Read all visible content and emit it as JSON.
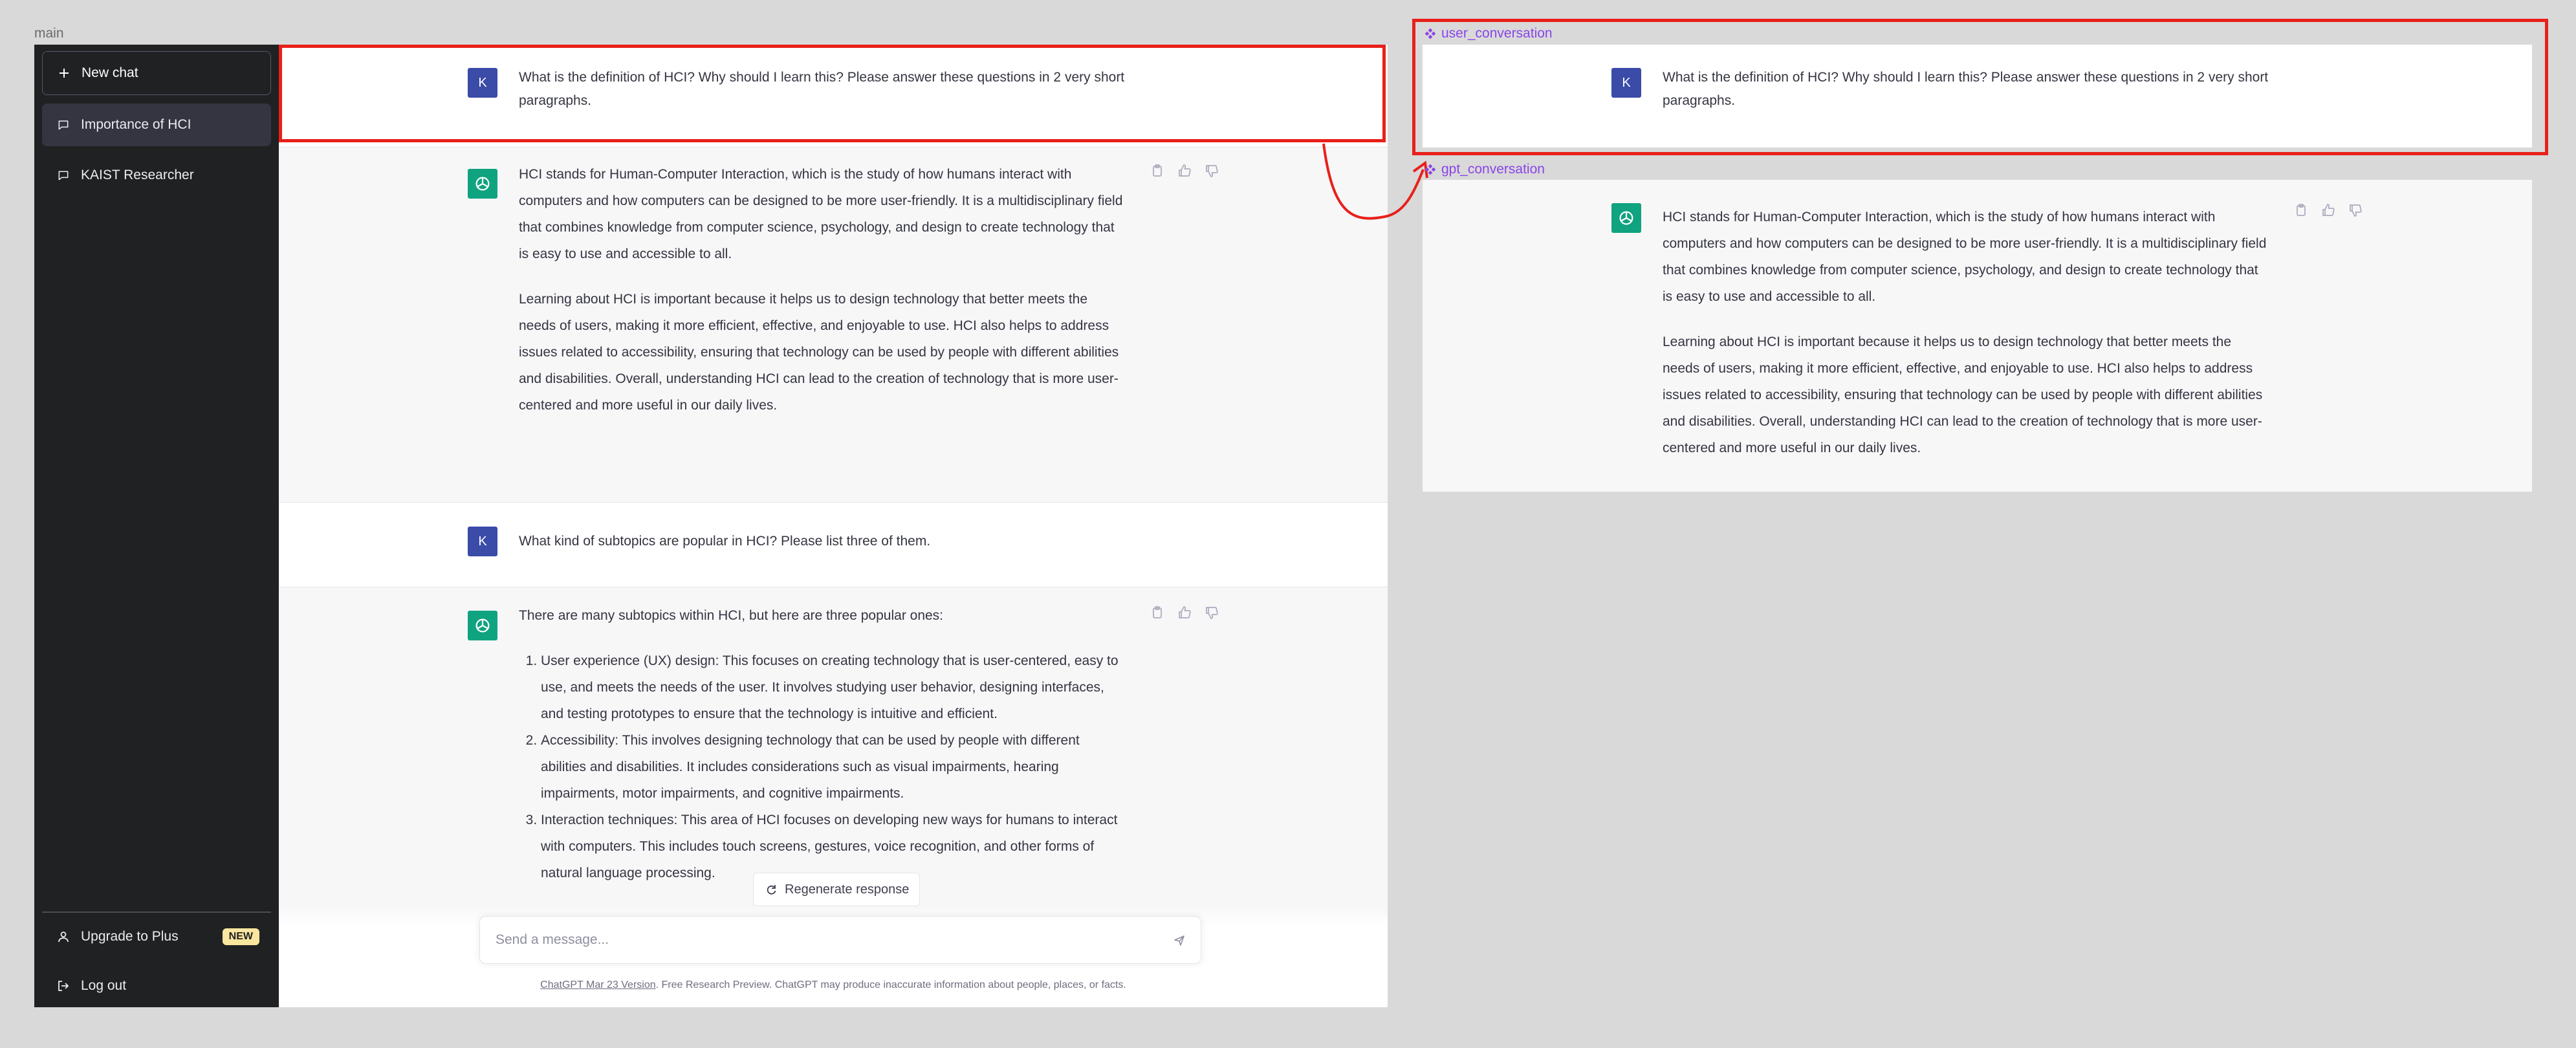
{
  "frames": {
    "main_label": "main",
    "user_component_label": "user_conversation",
    "gpt_component_label": "gpt_conversation"
  },
  "sidebar": {
    "new_chat": "New chat",
    "items": [
      {
        "label": "Importance of HCI",
        "active": true
      },
      {
        "label": "KAIST Researcher",
        "active": false
      }
    ],
    "upgrade": "Upgrade to Plus",
    "upgrade_badge": "NEW",
    "logout": "Log out"
  },
  "conversation": {
    "user_avatar_letter": "K",
    "q1": "What is the definition of HCI? Why should I learn this? Please answer these questions in 2 very short paragraphs.",
    "a1_p1": "HCI stands for Human-Computer Interaction, which is the study of how humans interact with computers and how computers can be designed to be more user-friendly. It is a multidisciplinary field that combines knowledge from computer science, psychology, and design to create technology that is easy to use and accessible to all.",
    "a1_p2": "Learning about HCI is important because it helps us to design technology that better meets the needs of users, making it more efficient, effective, and enjoyable to use. HCI also helps to address issues related to accessibility, ensuring that technology can be used by people with different abilities and disabilities. Overall, understanding HCI can lead to the creation of technology that is more user-centered and more useful in our daily lives.",
    "q2": "What kind of subtopics are popular in HCI? Please list three of them.",
    "a2_intro": "There are many subtopics within HCI, but here are three popular ones:",
    "a2_items": [
      "User experience (UX) design: This focuses on creating technology that is user-centered, easy to use, and meets the needs of the user. It involves studying user behavior, designing interfaces, and testing prototypes to ensure that the technology is intuitive and efficient.",
      "Accessibility: This involves designing technology that can be used by people with different abilities and disabilities. It includes considerations such as visual impairments, hearing impairments, motor impairments, and cognitive impairments.",
      "Interaction techniques: This area of HCI focuses on developing new ways for humans to interact with computers. This includes touch screens, gestures, voice recognition, and other forms of natural language processing."
    ]
  },
  "composer": {
    "regenerate": "Regenerate response",
    "placeholder": "Send a message...",
    "footer_link": "ChatGPT Mar 23 Version",
    "footer_text": ". Free Research Preview. ChatGPT may produce inaccurate information about people, places, or facts."
  },
  "colors": {
    "sidebar_bg": "#202123",
    "user_avatar": "#3b4ba8",
    "gpt_avatar": "#10a37f",
    "highlight": "#e8201a",
    "component_label": "#8a45e8"
  },
  "icons": [
    "plus-icon",
    "chat-bubble-icon",
    "user-icon",
    "logout-icon",
    "openai-logo-icon",
    "copy-icon",
    "thumbs-up-icon",
    "thumbs-down-icon",
    "refresh-icon",
    "send-icon",
    "component-icon"
  ]
}
